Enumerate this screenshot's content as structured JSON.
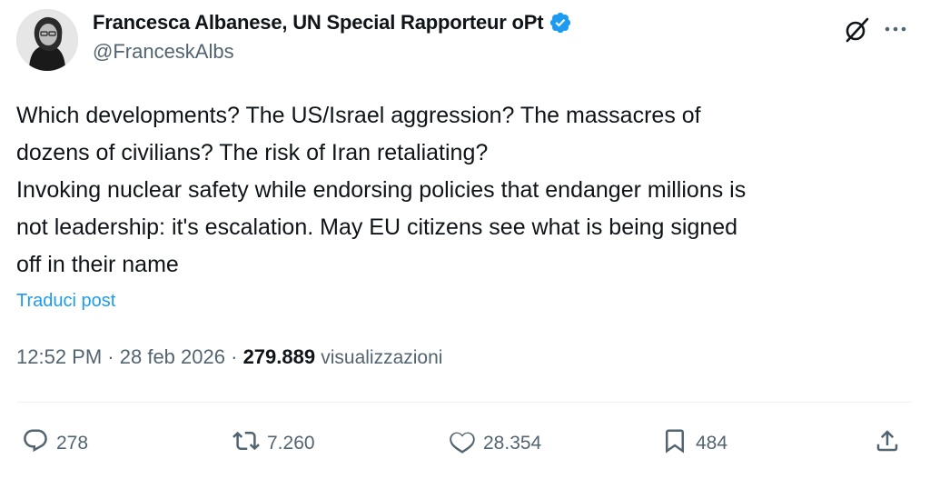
{
  "author": {
    "display_name": "Francesca Albanese, UN Special Rapporteur oPt",
    "handle": "@FranceskAlbs"
  },
  "post": {
    "lines": [
      "Which developments? The US/Israel aggression? The massacres of",
      "dozens of civilians? The risk of Iran retaliating?",
      "Invoking nuclear safety while endorsing policies that endanger millions is",
      "not leadership: it's escalation. May EU citizens see what is being signed",
      "off in their name"
    ],
    "translate_label": "Traduci post"
  },
  "meta": {
    "time": "12:52 PM",
    "separator": "·",
    "date": "28 feb 2026",
    "views_count": "279.889",
    "views_label": "visualizzazioni"
  },
  "actions": {
    "replies": "278",
    "reposts": "7.260",
    "likes": "28.354",
    "bookmarks": "484"
  },
  "icons": {
    "verified": "verified-badge-icon",
    "grok": "grok-icon",
    "more": "more-icon",
    "reply": "reply-icon",
    "repost": "repost-icon",
    "like": "heart-icon",
    "bookmark": "bookmark-icon",
    "share": "share-icon"
  },
  "colors": {
    "accent": "#1d9bf0",
    "text": "#0f1419",
    "muted": "#536471"
  }
}
